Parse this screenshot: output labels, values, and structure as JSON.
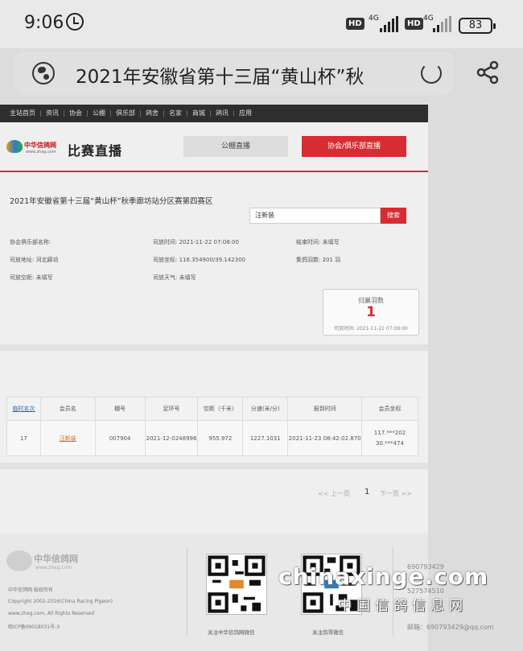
{
  "status_bar": {
    "time": "9:06",
    "sim1": {
      "hd": "HD",
      "net": "4G"
    },
    "sim2": {
      "hd": "HD",
      "net": "4G"
    },
    "battery": "83"
  },
  "address_bar": {
    "title": "2021年安徽省第十三届“黄山杯”秋",
    "left_icon": "globe-icon",
    "right_icon": "reload-icon",
    "share_icon": "share-icon"
  },
  "site": {
    "nav": [
      "主站首页",
      "资讯",
      "协会",
      "公棚",
      "俱乐部",
      "鸽舍",
      "名家",
      "商城",
      "鸽讯",
      "应用"
    ],
    "logo_name": "中华信鸽网",
    "logo_url": "www.zhxg.com",
    "section_title": "比赛直播",
    "tabs": {
      "public_loft": "公棚直播",
      "club": "协会/俱乐部直播"
    }
  },
  "race": {
    "title": "2021年安徽省第十三届“黄山杯”秋季廊坊站分区赛第四赛区",
    "search_value": "汪新装",
    "search_button": "搜索",
    "info": {
      "club_label": "协会俱乐部名称:",
      "release_time_label": "司放时间:",
      "release_time": "2021-11-22 07:08:00",
      "end_time_label": "结束时间:",
      "end_time": "未填写",
      "release_place_label": "司放地址:",
      "release_place": "河北廊坊",
      "release_coord_label": "司放坐标:",
      "release_coord": "116.354900/39.142300",
      "count_label": "集鸽羽数:",
      "count": "201 羽",
      "airspace_label": "司放空距:",
      "airspace": "未填写",
      "weather_label": "司放天气:",
      "weather": "未填写"
    },
    "homing": {
      "label": "归巢羽数",
      "value": "1",
      "time_label": "司放时间:",
      "time": "2021-11-22 07:08:00"
    }
  },
  "table": {
    "headers": [
      "临时名次",
      "会员名",
      "棚号",
      "足环号",
      "空距（千米）",
      "分速(米/分)",
      "报到时间",
      "会员坐标"
    ],
    "rows": [
      {
        "rank": "17",
        "member": "汪新装",
        "loft": "007904",
        "ring": "2021-12-0248996",
        "distance": "955.972",
        "speed": "1227.1031",
        "report_time": "2021-11-23 08:42:02.870",
        "coord_1": "117.***202",
        "coord_2": "30.***474"
      }
    ]
  },
  "pager": {
    "prev": "<< 上一页",
    "current": "1",
    "next": "下一页 >>"
  },
  "footer": {
    "logo_name": "中华信鸽网",
    "logo_url": "www.zhxg.com",
    "rights": "中华信鸽网 版权所有",
    "copyright": "Copyright 2002-2016(China Racing Pigeon)",
    "all_rights": "www.zhxg.com, All Rights Reserved",
    "icp": "皖ICP备09018031号-3",
    "qr1_caption": "关注中华信鸽网微信",
    "qr2_caption": "关注鸽哥微信",
    "contact": [
      "690793429",
      "527574510",
      "690793429@qq.com"
    ],
    "mail_label": "邮箱："
  },
  "watermark": {
    "latin": "chinaxinge.com",
    "cn": "中国信鸽信息网"
  }
}
